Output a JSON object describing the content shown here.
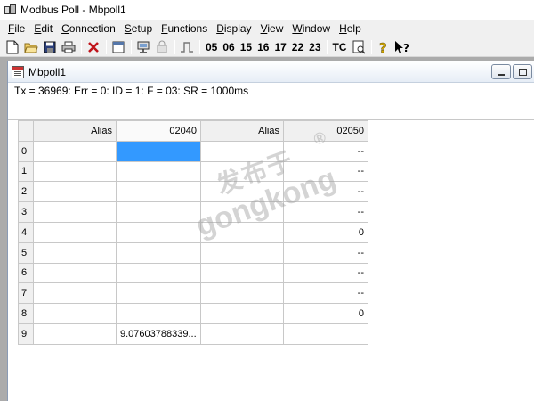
{
  "app": {
    "title": "Modbus Poll - Mbpoll1"
  },
  "menu": {
    "items": [
      {
        "label": "File",
        "ul": "F",
        "rest": "ile"
      },
      {
        "label": "Edit",
        "ul": "E",
        "rest": "dit"
      },
      {
        "label": "Connection",
        "ul": "C",
        "rest": "onnection"
      },
      {
        "label": "Setup",
        "ul": "S",
        "rest": "etup"
      },
      {
        "label": "Functions",
        "ul": "F",
        "rest": "unctions"
      },
      {
        "label": "Display",
        "ul": "D",
        "rest": "isplay"
      },
      {
        "label": "View",
        "ul": "V",
        "rest": "iew"
      },
      {
        "label": "Window",
        "ul": "W",
        "rest": "indow"
      },
      {
        "label": "Help",
        "ul": "H",
        "rest": "elp"
      }
    ]
  },
  "toolbar": {
    "icons": [
      "new-icon",
      "open-icon",
      "save-icon",
      "print-icon",
      "disconnect-icon",
      "window-icon",
      "connect-icon",
      "read-icon",
      "pulse-icon",
      "test-center-icon",
      "help-icon",
      "context-help-icon"
    ],
    "function_codes": [
      "05",
      "06",
      "15",
      "16",
      "17",
      "22",
      "23"
    ],
    "tc_label": "TC"
  },
  "window": {
    "title": "Mbpoll1",
    "status": "Tx = 36969: Err = 0: ID = 1: F = 03: SR = 1000ms"
  },
  "grid": {
    "headers": [
      "Alias",
      "02040",
      "Alias",
      "02050"
    ],
    "rows": [
      {
        "index": "0",
        "c1": "",
        "c2": "",
        "c3": "",
        "c4": "--"
      },
      {
        "index": "1",
        "c1": "",
        "c2": "",
        "c3": "",
        "c4": "--"
      },
      {
        "index": "2",
        "c1": "",
        "c2": "",
        "c3": "",
        "c4": "--"
      },
      {
        "index": "3",
        "c1": "",
        "c2": "",
        "c3": "",
        "c4": "--"
      },
      {
        "index": "4",
        "c1": "",
        "c2": "",
        "c3": "",
        "c4": "0"
      },
      {
        "index": "5",
        "c1": "",
        "c2": "",
        "c3": "",
        "c4": "--"
      },
      {
        "index": "6",
        "c1": "",
        "c2": "",
        "c3": "",
        "c4": "--"
      },
      {
        "index": "7",
        "c1": "",
        "c2": "",
        "c3": "",
        "c4": "--"
      },
      {
        "index": "8",
        "c1": "",
        "c2": "",
        "c3": "",
        "c4": "0"
      },
      {
        "index": "9",
        "c1": "",
        "c2": "9.07603788339...",
        "c3": "",
        "c4": ""
      }
    ],
    "selected_color": "#3399ff"
  },
  "watermark": {
    "cn": "发布于",
    "en": "gongkong",
    "reg": "®"
  }
}
